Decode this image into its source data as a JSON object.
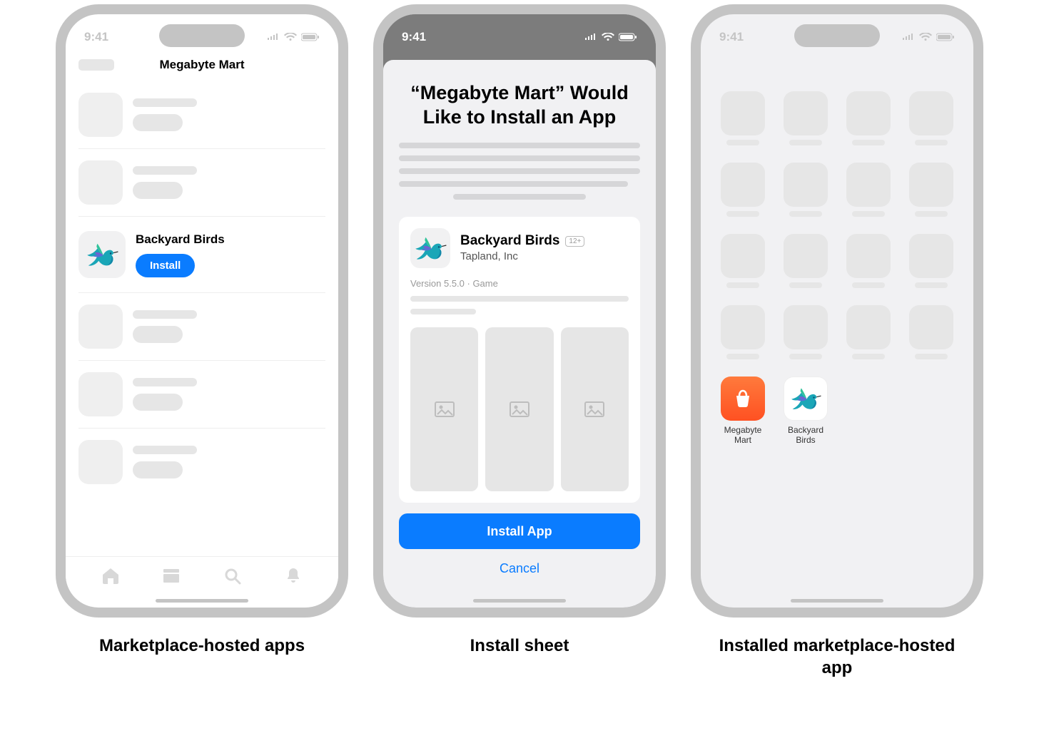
{
  "status_time": "9:41",
  "phone1": {
    "nav_title": "Megabyte Mart",
    "app_name": "Backyard Birds",
    "install_label": "Install"
  },
  "phone2": {
    "sheet_title": "“Megabyte Mart” Would Like to Install an App",
    "app_name": "Backyard Birds",
    "developer": "Tapland, Inc",
    "age_rating": "12+",
    "meta": "Version 5.5.0 · Game",
    "install_app_label": "Install App",
    "cancel_label": "Cancel"
  },
  "phone3": {
    "app1_label": "Megabyte Mart",
    "app2_label": "Backyard Birds"
  },
  "captions": {
    "c1": "Marketplace-hosted apps",
    "c2": "Install sheet",
    "c3": "Installed marketplace-hosted app"
  }
}
